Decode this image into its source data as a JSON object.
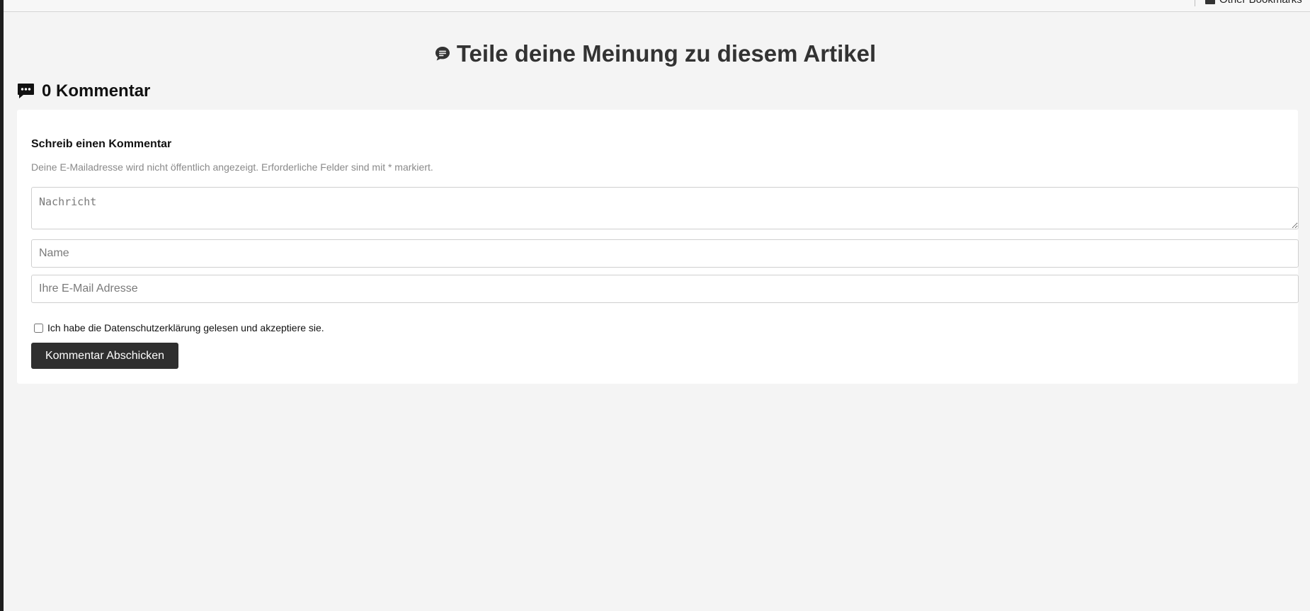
{
  "bookmarks_bar": {
    "other_bookmarks_label": "Other Bookmarks",
    "folder_icon": "folder-icon"
  },
  "page": {
    "heading": "Teile deine Meinung zu diesem Artikel",
    "heading_icon": "comment-bubble-icon",
    "comment_count_label": "0 Kommentar",
    "comment_count_icon": "comment-dots-icon"
  },
  "comment_form": {
    "title": "Schreib einen Kommentar",
    "note": "Deine E-Mailadresse wird nicht öffentlich angezeigt. Erforderliche Felder sind mit * markiert.",
    "message_placeholder": "Nachricht",
    "message_value": "",
    "name_placeholder": "Name",
    "name_value": "",
    "email_placeholder": "Ihre E-Mail Adresse",
    "email_value": "",
    "consent_label": "Ich habe die Datenschutzerklärung gelesen und akzeptiere sie.",
    "consent_checked": false,
    "submit_label": "Kommentar Abschicken"
  },
  "colors": {
    "page_background": "#f4f4f4",
    "card_background": "#ffffff",
    "heading_text": "#333333",
    "button_background": "#2f2f2f",
    "note_text": "#8a8a8a"
  }
}
